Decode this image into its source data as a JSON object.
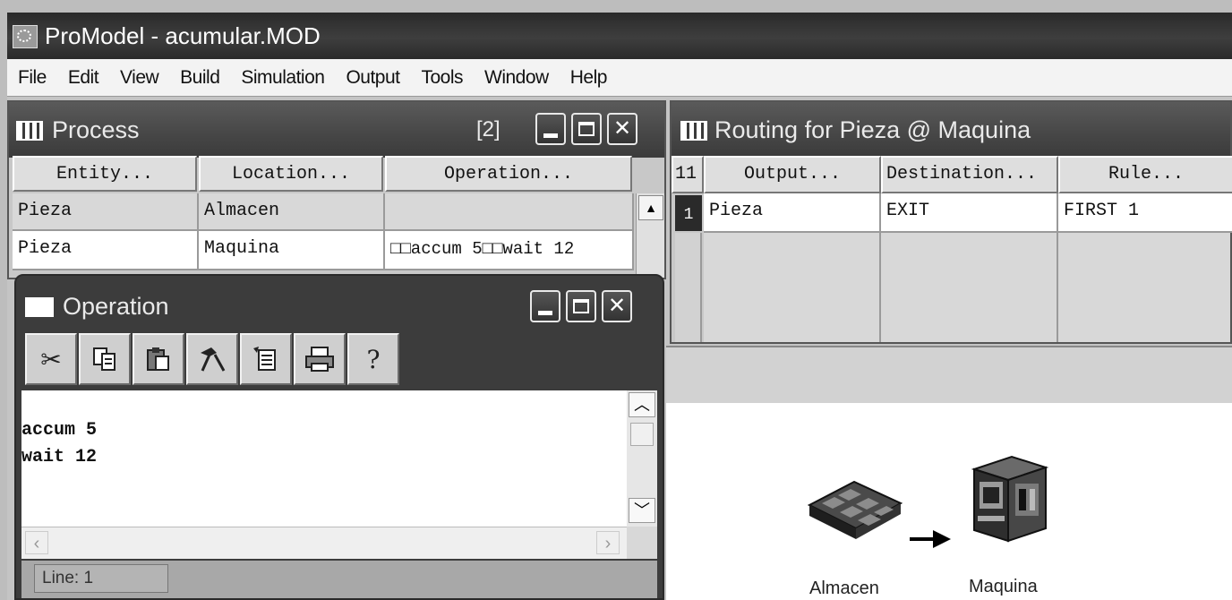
{
  "app": {
    "title": "ProModel - acumular.MOD"
  },
  "menu": [
    "File",
    "Edit",
    "View",
    "Build",
    "Simulation",
    "Output",
    "Tools",
    "Window",
    "Help"
  ],
  "process": {
    "title": "Process",
    "badge": "[2]",
    "headers": [
      "Entity...",
      "Location...",
      "Operation..."
    ],
    "rows": [
      [
        "Pieza",
        "Almacen",
        ""
      ],
      [
        "Pieza",
        "Maquina",
        "□□accum 5□□wait 12"
      ]
    ]
  },
  "routing": {
    "title": "Routing for Pieza @ Maquina",
    "headers": [
      "11",
      "Output...",
      "Destination...",
      "Rule..."
    ],
    "rows": [
      [
        "1",
        "Pieza",
        "EXIT",
        "FIRST 1"
      ]
    ]
  },
  "operation": {
    "title": "Operation",
    "lines": [
      "accum 5",
      "wait 12"
    ],
    "status": "Line: 1"
  },
  "layout": {
    "labels": [
      "Almacen",
      "Maquina"
    ]
  },
  "colors": {
    "titlebar": "#2e2e2e",
    "child_titlebar": "#4a4a4a",
    "selected_row": "#2a2a2a"
  }
}
